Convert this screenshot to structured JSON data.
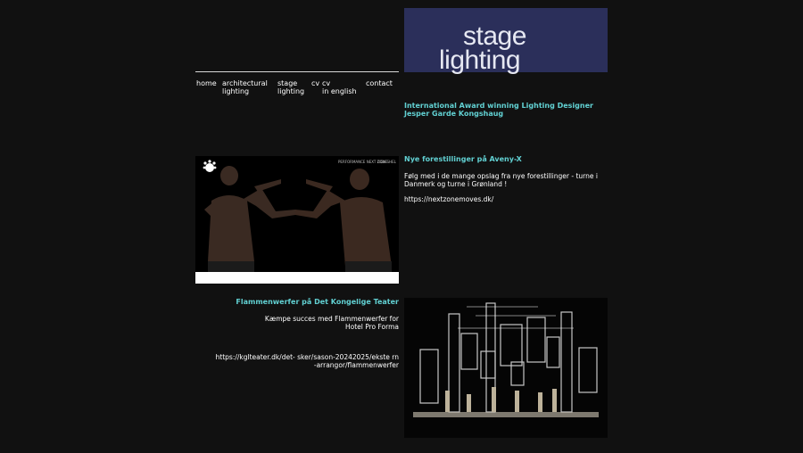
{
  "banner": {
    "line1": "stage",
    "line2": "lighting"
  },
  "nav": {
    "items": [
      {
        "label": "home",
        "name": "nav-home"
      },
      {
        "label": "architectural\nlighting",
        "name": "nav-architectural-lighting"
      },
      {
        "label": "stage\nlighting",
        "name": "nav-stage-lighting"
      },
      {
        "label": "cv",
        "name": "nav-cv"
      },
      {
        "label": "cv\nin english",
        "name": "nav-cv-english"
      },
      {
        "label": "contact",
        "name": "nav-contact"
      }
    ]
  },
  "intro": {
    "text": "International Award winning Lighting Designer Jesper Garde Kongshaug"
  },
  "post1": {
    "heading": "Nye forestillinger på Aveny-X",
    "body": "Følg med i de mange opslag fra nye forestillinger - turne i Danmerk og turne i Grønland !",
    "link": "https://nextzonemoves.dk/",
    "image_caption_left": "PERFORMANCE  NEXT ZONE",
    "image_caption_right": "LIGA  SHEL"
  },
  "post2": {
    "heading": "Flammenwerfer på Det Kongelige Teater",
    "body": "Kæmpe succes med Flammenwerfer for Hotel Pro Forma",
    "link": "https://kglteater.dk/det- sker/sason-20242025/ekste rn-arrangor/flammenwerfer"
  },
  "colors": {
    "background": "#111111",
    "banner": "#2b2f5a",
    "accent": "#61d0d2",
    "text": "#ffffff"
  }
}
